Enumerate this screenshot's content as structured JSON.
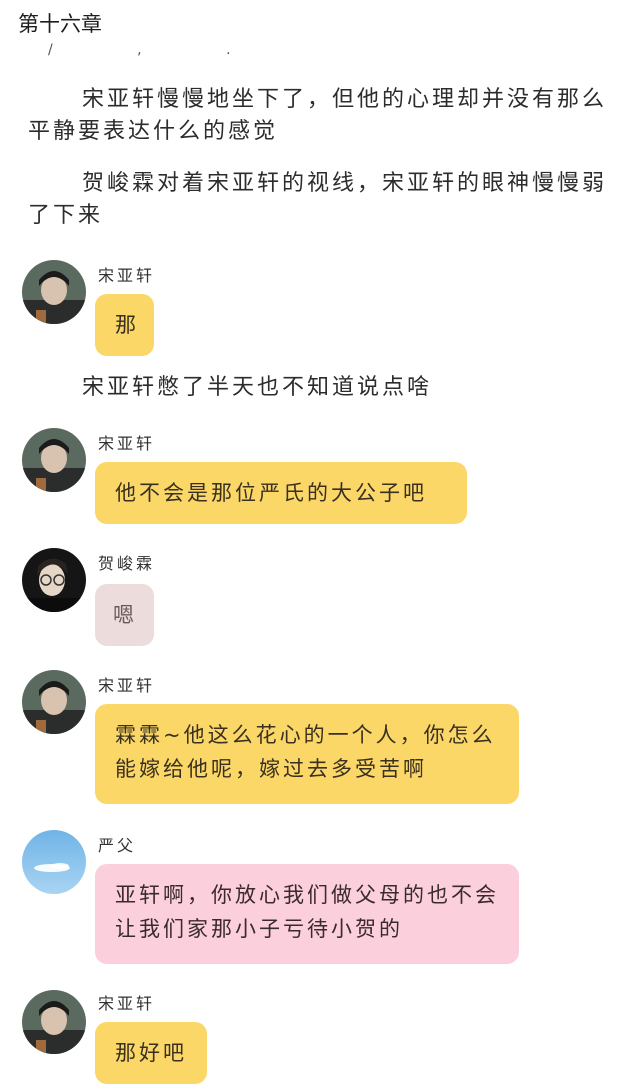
{
  "chapter_title": "第十六章",
  "stray_marks": "/ ,  .",
  "narration": [
    "宋亚轩慢慢地坐下了，但他的心理却并没有那么平静要表达什么的感觉",
    "贺峻霖对着宋亚轩的视线，宋亚轩的眼神慢慢弱了下来",
    "宋亚轩憋了半天也不知道说点啥"
  ],
  "messages": [
    {
      "speaker": "宋亚轩",
      "text": "那",
      "avatar": "boy-avatar"
    },
    {
      "speaker": "宋亚轩",
      "text": "他不会是那位严氏的大公子吧",
      "avatar": "boy-avatar"
    },
    {
      "speaker": "贺峻霖",
      "text": "嗯",
      "avatar": "glasses-boy-avatar"
    },
    {
      "speaker": "宋亚轩",
      "text": "霖霖~他这么花心的一个人，你怎么能嫁给他呢，嫁过去多受苦啊",
      "avatar": "boy-avatar"
    },
    {
      "speaker": "严父",
      "text": "亚轩啊，你放心我们做父母的也不会让我们家那小子亏待小贺的",
      "avatar": "sky-cloud-avatar"
    },
    {
      "speaker": "宋亚轩",
      "text": "那好吧",
      "avatar": "boy-avatar"
    }
  ],
  "colors": {
    "bubble_yellow": "#fbd767",
    "bubble_grey": "#ecdcdc",
    "bubble_pink": "#fbd0dc"
  }
}
